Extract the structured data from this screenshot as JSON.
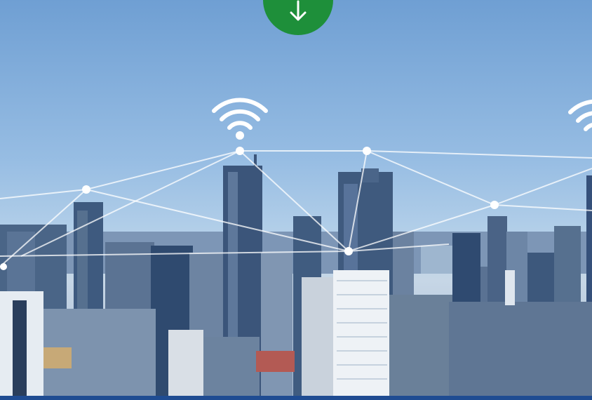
{
  "scene": {
    "subject": "city skyline",
    "icons": [
      "wifi-signal-icon",
      "wifi-signal-icon",
      "download-arrow-icon"
    ]
  },
  "colors": {
    "download_button": "#1e8f3a",
    "bottom_bar": "#1f4c92",
    "sky_top": "#6f9fd3",
    "network_lines": "#ffffff"
  }
}
